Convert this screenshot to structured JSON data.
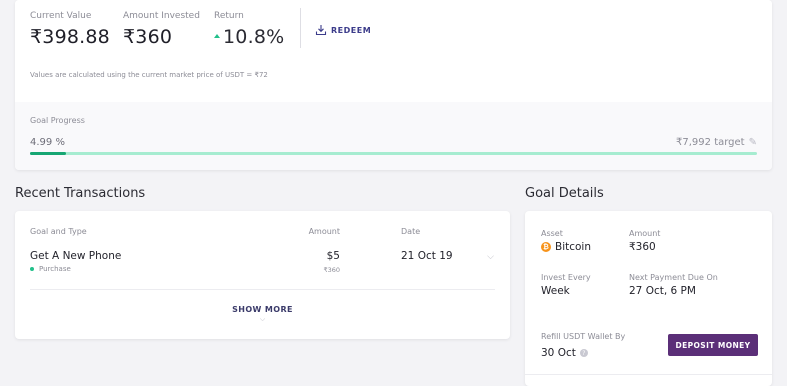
{
  "summary": {
    "current_value_label": "Current Value",
    "current_value": "₹398.88",
    "amount_invested_label": "Amount Invested",
    "amount_invested": "₹360",
    "return_label": "Return",
    "return_value": "10.8%",
    "redeem_label": "REDEEM",
    "note": "Values are calculated using the current market price of USDT = ₹72"
  },
  "goal_progress": {
    "label": "Goal Progress",
    "percent_text": "4.99 %",
    "progress": 0.0499,
    "target": "₹7,992 target"
  },
  "transactions": {
    "title": "Recent Transactions",
    "columns": [
      "Goal and Type",
      "Amount",
      "Date"
    ],
    "rows": [
      {
        "name": "Get A New Phone",
        "type": "Purchase",
        "amount": "$5",
        "amount_inr": "₹360",
        "date": "21 Oct 19"
      }
    ],
    "show_more": "SHOW MORE"
  },
  "goal_details": {
    "title": "Goal Details",
    "asset_label": "Asset",
    "asset": "Bitcoin",
    "asset_icon": "bitcoin-icon",
    "amount_label": "Amount",
    "amount": "₹360",
    "invest_every_label": "Invest Every",
    "invest_every": "Week",
    "next_payment_label": "Next Payment Due On",
    "next_payment": "27 Oct, 6 PM",
    "refill_label": "Refill USDT Wallet By",
    "refill_date": "30 Oct",
    "deposit_label": "DEPOSIT MONEY"
  },
  "colors": {
    "accent_green": "#22c08a",
    "progress_fill": "#17a673",
    "progress_track": "#a6ecd0",
    "deposit_button": "#5b2f78",
    "bitcoin": "#f7931a"
  }
}
